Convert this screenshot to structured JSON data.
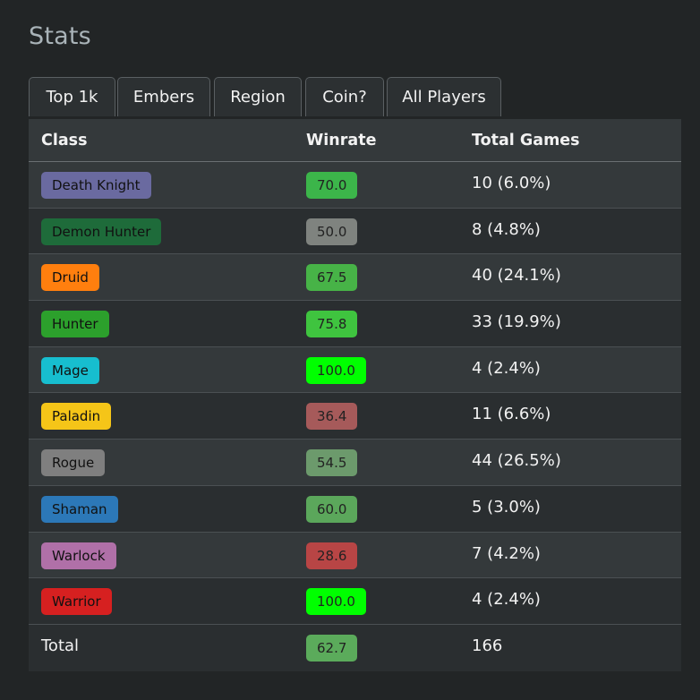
{
  "page": {
    "title": "Stats"
  },
  "tabs": [
    {
      "label": "Top 1k"
    },
    {
      "label": "Embers"
    },
    {
      "label": "Region"
    },
    {
      "label": "Coin?"
    },
    {
      "label": "All Players"
    }
  ],
  "table": {
    "headers": {
      "class": "Class",
      "winrate": "Winrate",
      "games": "Total Games"
    },
    "rows": [
      {
        "class": "Death Knight",
        "winrate": "70.0",
        "games": "10 (6.0%)",
        "class_color": "#6a6aa0",
        "class_text": "#111111",
        "win_color": "#3cb54a"
      },
      {
        "class": "Demon Hunter",
        "winrate": "50.0",
        "games": "8 (4.8%)",
        "class_color": "#1e6b3a",
        "class_text": "#111111",
        "win_color": "#7f837f"
      },
      {
        "class": "Druid",
        "winrate": "67.5",
        "games": "40 (24.1%)",
        "class_color": "#ff7f0e",
        "class_text": "#111111",
        "win_color": "#47b347"
      },
      {
        "class": "Hunter",
        "winrate": "75.8",
        "games": "33 (19.9%)",
        "class_color": "#2ca02c",
        "class_text": "#111111",
        "win_color": "#3fc43f"
      },
      {
        "class": "Mage",
        "winrate": "100.0",
        "games": "4 (2.4%)",
        "class_color": "#17becf",
        "class_text": "#111111",
        "win_color": "#00ff00"
      },
      {
        "class": "Paladin",
        "winrate": "36.4",
        "games": "11 (6.6%)",
        "class_color": "#f5c518",
        "class_text": "#111111",
        "win_color": "#a65a5a"
      },
      {
        "class": "Rogue",
        "winrate": "54.5",
        "games": "44 (26.5%)",
        "class_color": "#7f7f7f",
        "class_text": "#111111",
        "win_color": "#6c9a6c"
      },
      {
        "class": "Shaman",
        "winrate": "60.0",
        "games": "5 (3.0%)",
        "class_color": "#2c78b8",
        "class_text": "#111111",
        "win_color": "#5ba75b"
      },
      {
        "class": "Warlock",
        "winrate": "28.6",
        "games": "7 (4.2%)",
        "class_color": "#b070a8",
        "class_text": "#111111",
        "win_color": "#b84545"
      },
      {
        "class": "Warrior",
        "winrate": "100.0",
        "games": "4 (2.4%)",
        "class_color": "#d62020",
        "class_text": "#111111",
        "win_color": "#00ff00"
      }
    ],
    "total": {
      "label": "Total",
      "winrate": "62.7",
      "games": "166",
      "win_color": "#5bab5b"
    }
  }
}
